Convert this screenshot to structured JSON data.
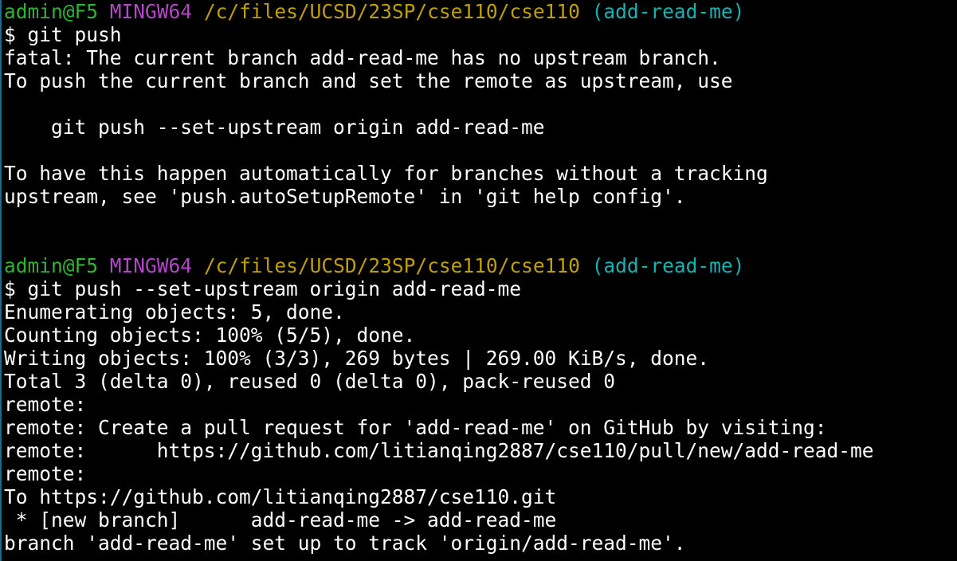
{
  "colors": {
    "background": "#000000",
    "text": "#ffffff",
    "prompt_user": "#2fb52f",
    "prompt_env": "#b347c8",
    "prompt_path": "#c0a000",
    "prompt_branch": "#19b2b2"
  },
  "prompts": [
    {
      "user_host": "admin@F5",
      "env": "MINGW64",
      "path": "/c/files/UCSD/23SP/cse110/cse110",
      "branch": "(add-read-me)",
      "command": "$ git push"
    },
    {
      "user_host": "admin@F5",
      "env": "MINGW64",
      "path": "/c/files/UCSD/23SP/cse110/cse110",
      "branch": "(add-read-me)",
      "command": "$ git push --set-upstream origin add-read-me"
    }
  ],
  "output1": [
    "fatal: The current branch add-read-me has no upstream branch.",
    "To push the current branch and set the remote as upstream, use",
    "",
    "    git push --set-upstream origin add-read-me",
    "",
    "To have this happen automatically for branches without a tracking",
    "upstream, see 'push.autoSetupRemote' in 'git help config'.",
    "",
    ""
  ],
  "output2": [
    "Enumerating objects: 5, done.",
    "Counting objects: 100% (5/5), done.",
    "Writing objects: 100% (3/3), 269 bytes | 269.00 KiB/s, done.",
    "Total 3 (delta 0), reused 0 (delta 0), pack-reused 0",
    "remote:",
    "remote: Create a pull request for 'add-read-me' on GitHub by visiting:",
    "remote:      https://github.com/litianqing2887/cse110/pull/new/add-read-me",
    "remote:",
    "To https://github.com/litianqing2887/cse110.git",
    " * [new branch]      add-read-me -> add-read-me",
    "branch 'add-read-me' set up to track 'origin/add-read-me'."
  ]
}
